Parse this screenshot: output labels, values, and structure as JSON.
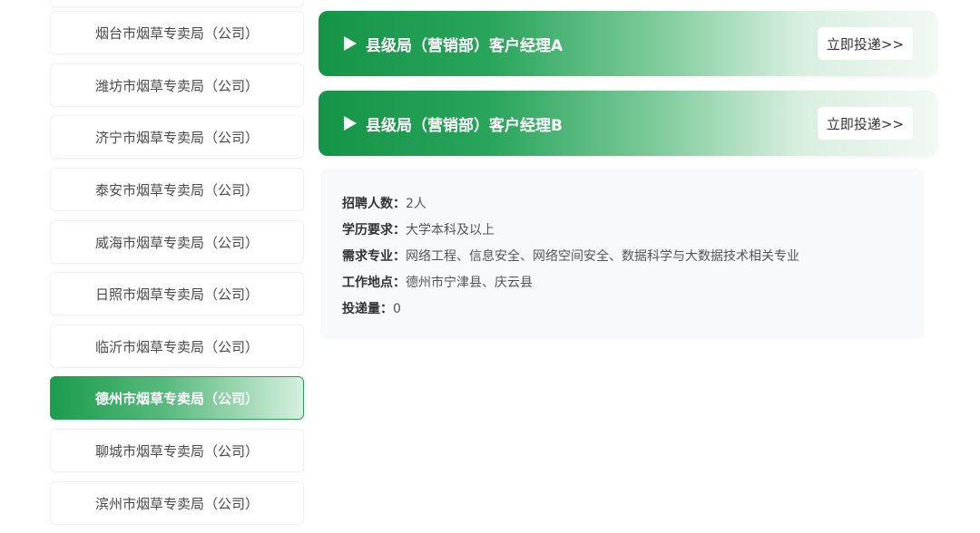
{
  "sidebar": {
    "items": [
      {
        "label": "",
        "active": false
      },
      {
        "label": "烟台市烟草专卖局（公司）",
        "active": false
      },
      {
        "label": "潍坊市烟草专卖局（公司）",
        "active": false
      },
      {
        "label": "济宁市烟草专卖局（公司）",
        "active": false
      },
      {
        "label": "泰安市烟草专卖局（公司）",
        "active": false
      },
      {
        "label": "威海市烟草专卖局（公司）",
        "active": false
      },
      {
        "label": "日照市烟草专卖局（公司）",
        "active": false
      },
      {
        "label": "临沂市烟草专卖局（公司）",
        "active": false
      },
      {
        "label": "德州市烟草专卖局（公司）",
        "active": true
      },
      {
        "label": "聊城市烟草专卖局（公司）",
        "active": false
      },
      {
        "label": "滨州市烟草专卖局（公司）",
        "active": false
      }
    ]
  },
  "jobs": [
    {
      "title": "县级局（营销部）客户经理A",
      "apply_label": "立即投递>>"
    },
    {
      "title": "县级局（营销部）客户经理B",
      "apply_label": "立即投递>>"
    }
  ],
  "detail": {
    "headcount_label": "招聘人数：",
    "headcount_value": "2人",
    "education_label": "学历要求：",
    "education_value": "大学本科及以上",
    "major_label": "需求专业：",
    "major_value": "网络工程、信息安全、网络空间安全、数据科学与大数据技术相关专业",
    "location_label": "工作地点：",
    "location_value": "德州市宁津县、庆云县",
    "applications_label": "投递量：",
    "applications_value": "0"
  },
  "colors": {
    "brand_green": "#1b9c4e",
    "card_green": "#159447",
    "panel_bg": "#f7f9fb"
  }
}
